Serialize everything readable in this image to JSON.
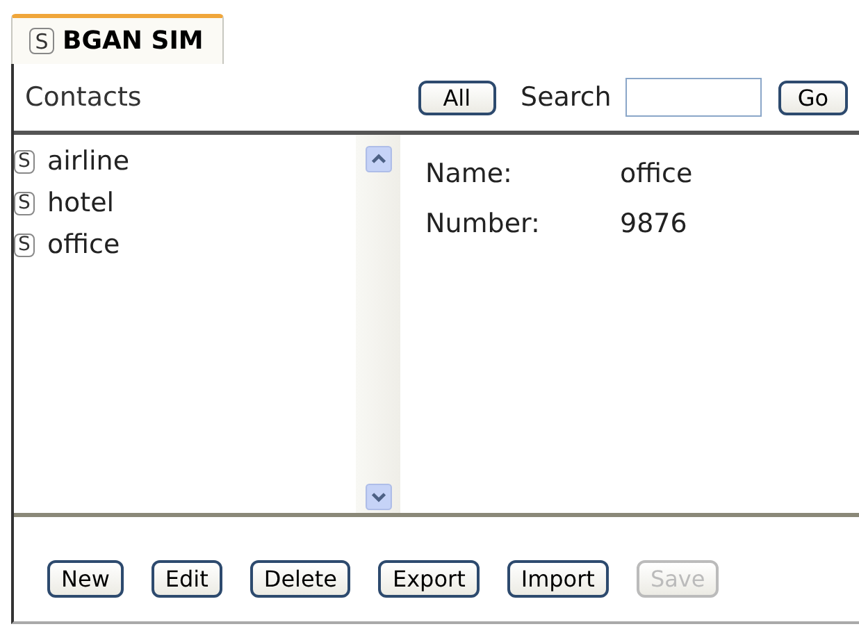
{
  "tab": {
    "badge": "S",
    "label": "BGAN SIM",
    "selected": true
  },
  "header": {
    "title": "Contacts",
    "all_button": "All",
    "search_label": "Search",
    "go_button": "Go"
  },
  "contacts": [
    {
      "badge": "S",
      "name": "airline"
    },
    {
      "badge": "S",
      "name": "hotel"
    },
    {
      "badge": "S",
      "name": "office"
    }
  ],
  "details": [
    {
      "label": "Name:",
      "value": "office"
    },
    {
      "label": "Number:",
      "value": "9876"
    }
  ],
  "buttons": [
    {
      "label": "New",
      "disabled": false
    },
    {
      "label": "Edit",
      "disabled": false
    },
    {
      "label": "Delete",
      "disabled": false
    },
    {
      "label": "Export",
      "disabled": false
    },
    {
      "label": "Import",
      "disabled": false
    },
    {
      "label": "Save",
      "disabled": true
    }
  ]
}
